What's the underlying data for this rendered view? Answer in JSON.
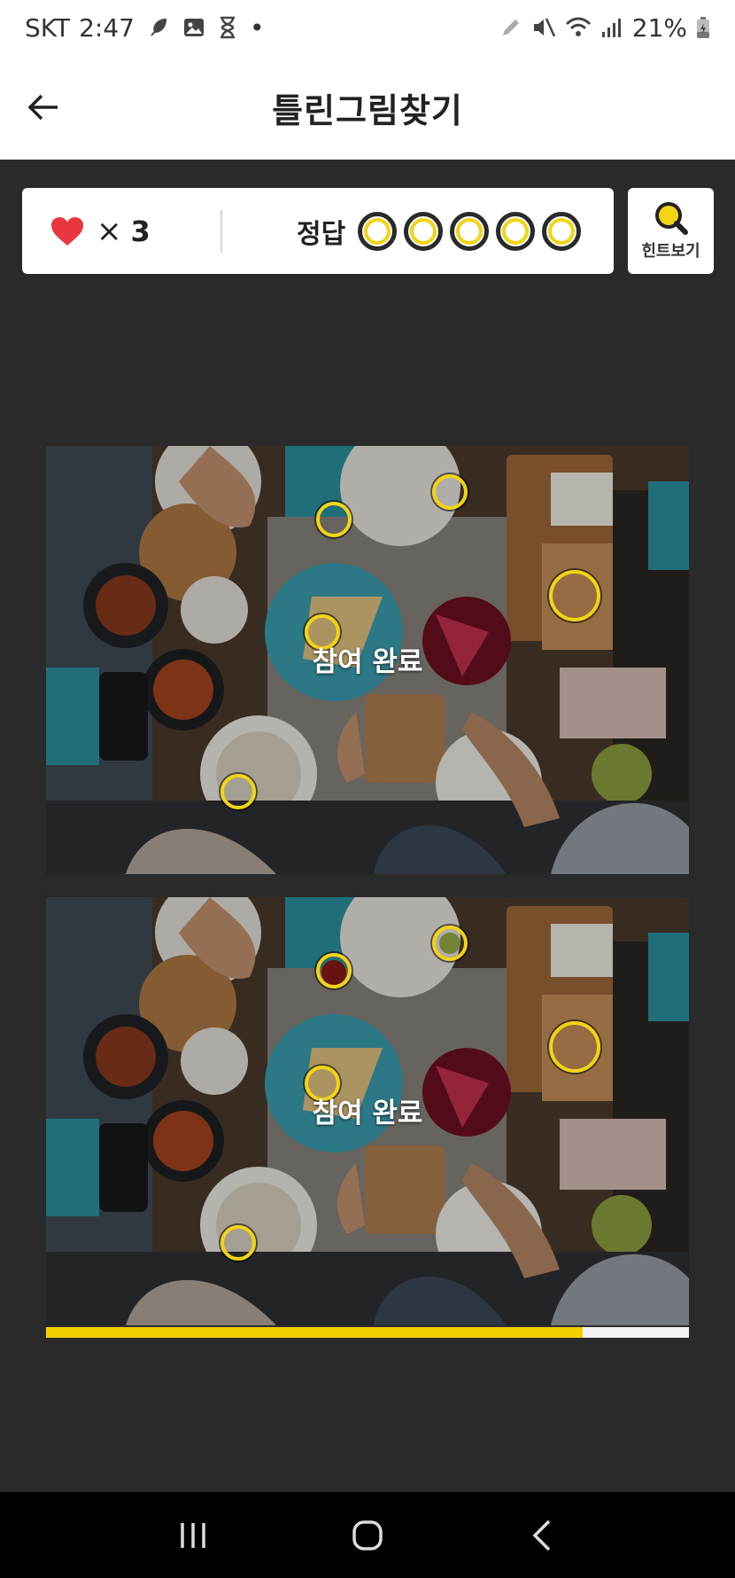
{
  "status_bar": {
    "carrier": "SKT",
    "time": "2:47",
    "dot": "•",
    "battery": "21%",
    "left_icons": [
      "feather-icon",
      "image-icon",
      "hourglass-icon"
    ],
    "right_icons": [
      "pencil-icon",
      "mute-icon",
      "wifi-icon",
      "signal-icon",
      "battery-charging-icon"
    ]
  },
  "header": {
    "title": "틀린그림찾기",
    "back_icon": "arrow-left-icon"
  },
  "score": {
    "lives_icon": "heart-icon",
    "lives_prefix": "×",
    "lives_count": "3",
    "answers_label": "정답",
    "answer_slots": 5,
    "answers_found": 5
  },
  "hint": {
    "label": "힌트보기",
    "icon": "magnifier-icon"
  },
  "photos": {
    "top_label": "참여 완료",
    "bottom_label": "참여 완료"
  },
  "progress": {
    "fraction": 0.835
  },
  "colors": {
    "accent_yellow": "#f2d415",
    "heart_red": "#e8373f",
    "background": "#2a2a2a"
  },
  "nav": {
    "recent_icon": "recent-apps-icon",
    "home_icon": "home-icon",
    "back_icon": "nav-back-icon"
  }
}
